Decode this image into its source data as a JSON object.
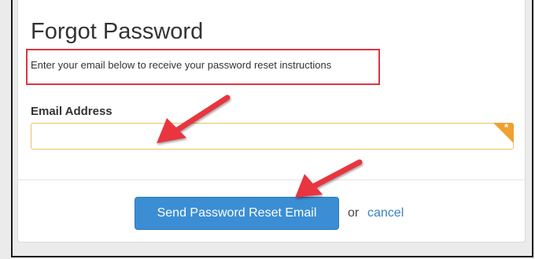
{
  "form": {
    "title": "Forgot Password",
    "instructions": "Enter your email below to receive your password reset instructions",
    "email_label": "Email Address",
    "email_value": "",
    "required_marker": "*",
    "submit_label": "Send Password Reset Email",
    "or_text": "or",
    "cancel_label": "cancel"
  },
  "annotations": {
    "highlight_color": "#e03340",
    "arrow_color": "#e8363f"
  },
  "colors": {
    "primary_button": "#3b8ed4",
    "link": "#3a7fc4",
    "required_accent": "#f0a030"
  }
}
